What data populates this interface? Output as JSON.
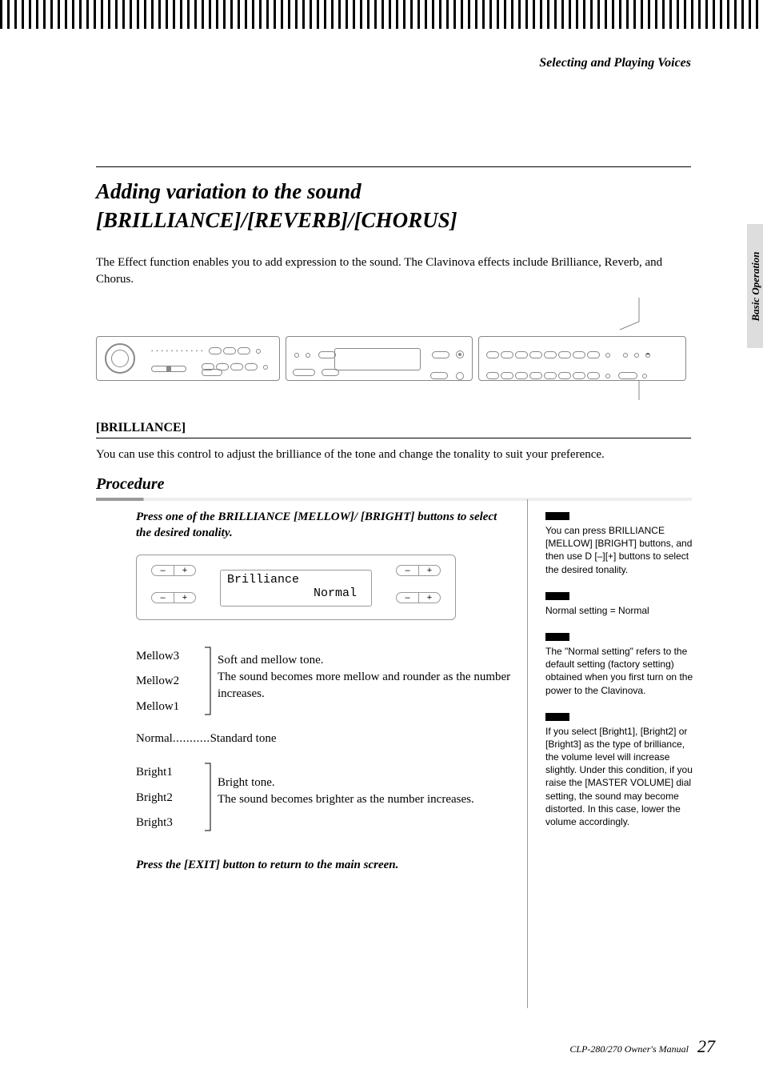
{
  "breadcrumb": "Selecting and Playing Voices",
  "title_line1": "Adding variation to the sound",
  "title_line2": "[BRILLIANCE]/[REVERB]/[CHORUS]",
  "intro": "The Effect function enables you to add expression to the sound. The Clavinova effects include Brilliance, Reverb, and Chorus.",
  "section_head": "[BRILLIANCE]",
  "section_desc": "You can use this control to adjust the brilliance of the tone and change the tonality to suit your preference.",
  "procedure_head": "Procedure",
  "step_instruction": "Press one of the BRILLIANCE [MELLOW]/ [BRIGHT] buttons to select the desired tonality.",
  "lcd": {
    "line1": "Brilliance",
    "line2": "Normal"
  },
  "pm_minus": "–",
  "pm_plus": "+",
  "mellow": {
    "labels": [
      "Mellow3",
      "Mellow2",
      "Mellow1"
    ],
    "desc": "Soft and mellow tone.\nThe sound becomes more mellow and rounder as the number increases."
  },
  "normal_label": "Normal",
  "normal_dots": "...........",
  "normal_desc": "Standard tone",
  "bright": {
    "labels": [
      "Bright1",
      "Bright2",
      "Bright3"
    ],
    "desc": "Bright tone.\nThe sound becomes brighter as the number increases."
  },
  "exit_instruction": "Press the [EXIT] button to return to the main screen.",
  "sidebar": {
    "note1": "You can press BRILLIANCE [MELLOW] [BRIGHT] buttons, and then use D [–][+] buttons to select the desired tonality.",
    "note2": "Normal setting = Normal",
    "note3": "The \"Normal setting\" refers to the default setting (factory setting) obtained when you first turn on the power to the Clavinova.",
    "note4": "If you select [Bright1], [Bright2] or [Bright3] as the type of brilliance, the volume level will increase slightly. Under this condition, if you raise the [MASTER VOLUME] dial setting, the sound may become distorted. In this case, lower the volume accordingly."
  },
  "side_tab": "Basic Operation",
  "footer_manual": "CLP-280/270 Owner's Manual",
  "footer_page": "27"
}
